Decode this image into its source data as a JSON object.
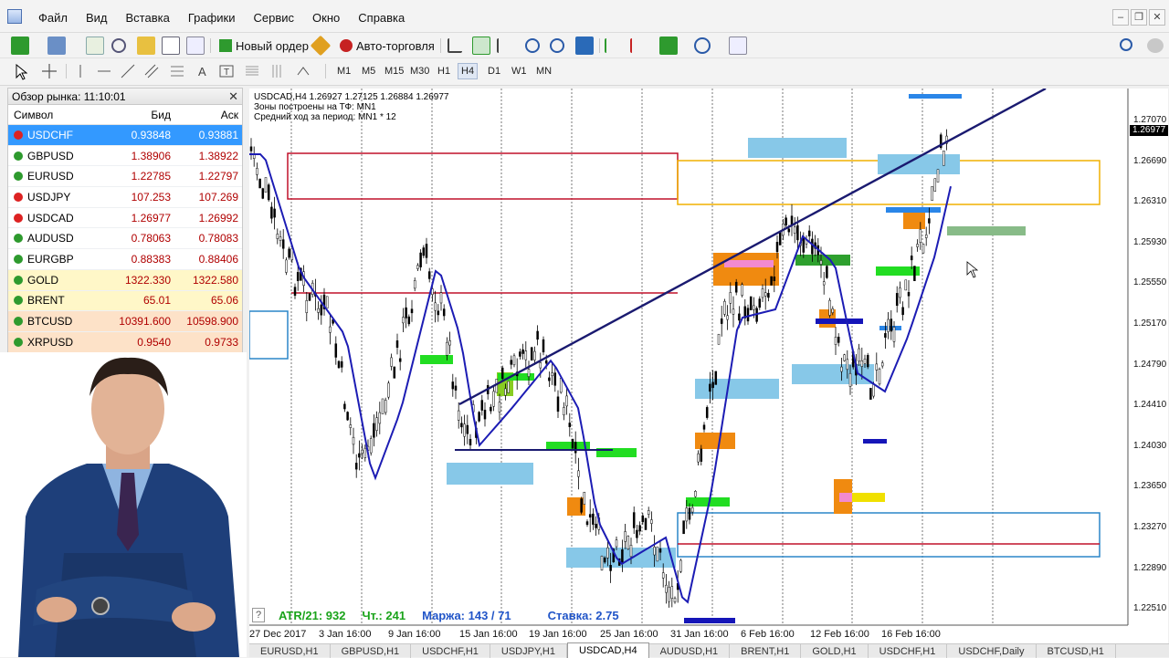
{
  "menu": {
    "items": [
      "Файл",
      "Вид",
      "Вставка",
      "Графики",
      "Сервис",
      "Окно",
      "Справка"
    ]
  },
  "toolbar": {
    "new_order": "Новый ордер",
    "auto_trading": "Авто-торговля",
    "timeframes": [
      "M1",
      "M5",
      "M15",
      "M30",
      "H1",
      "H4",
      "D1",
      "W1",
      "MN"
    ],
    "active_timeframe": "H4"
  },
  "market_watch": {
    "title": "Обзор рынка: 11:10:01",
    "col_symbol": "Символ",
    "col_bid": "Бид",
    "col_ask": "Аск",
    "rows": [
      {
        "symbol": "USDCHF",
        "bid": "0.93848",
        "ask": "0.93881",
        "dir": "down",
        "selected": true
      },
      {
        "symbol": "GBPUSD",
        "bid": "1.38906",
        "ask": "1.38922",
        "dir": "up"
      },
      {
        "symbol": "EURUSD",
        "bid": "1.22785",
        "ask": "1.22797",
        "dir": "up"
      },
      {
        "symbol": "USDJPY",
        "bid": "107.253",
        "ask": "107.269",
        "dir": "down"
      },
      {
        "symbol": "USDCAD",
        "bid": "1.26977",
        "ask": "1.26992",
        "dir": "down"
      },
      {
        "symbol": "AUDUSD",
        "bid": "0.78063",
        "ask": "0.78083",
        "dir": "up"
      },
      {
        "symbol": "EURGBP",
        "bid": "0.88383",
        "ask": "0.88406",
        "dir": "up"
      },
      {
        "symbol": "GOLD",
        "bid": "1322.330",
        "ask": "1322.580",
        "dir": "up"
      },
      {
        "symbol": "BRENT",
        "bid": "65.01",
        "ask": "65.06",
        "dir": "up"
      },
      {
        "symbol": "BTCUSD",
        "bid": "10391.600",
        "ask": "10598.900",
        "dir": "up"
      },
      {
        "symbol": "XRPUSD",
        "bid": "0.9540",
        "ask": "0.9733",
        "dir": "up"
      }
    ]
  },
  "chart": {
    "header_line1": "USDCAD,H4  1.26927 1.27125 1.26884 1.26977",
    "header_line2": "Зоны построены на ТФ: MN1",
    "header_line3": "Средний ход за период: MN1 * 12",
    "price_labels": [
      "1.27070",
      "1.26690",
      "1.26310",
      "1.25930",
      "1.25550",
      "1.25170",
      "1.24790",
      "1.24410",
      "1.24030",
      "1.23650",
      "1.23270",
      "1.22890",
      "1.22510"
    ],
    "current_price": "1.26977",
    "time_labels": [
      "27 Dec 2017",
      "3 Jan 16:00",
      "9 Jan 16:00",
      "15 Jan 16:00",
      "19 Jan 16:00",
      "25 Jan 16:00",
      "31 Jan 16:00",
      "6 Feb 16:00",
      "12 Feb 16:00",
      "16 Feb 16:00"
    ],
    "help": "?",
    "atr": "ATR/21: 932",
    "ticks": "Чт.: 241",
    "margin": "Маржа: 143 / 71",
    "rate": "Ставка: 2.75"
  },
  "tabs": [
    "EURUSD,H1",
    "GBPUSD,H1",
    "USDCHF,H1",
    "USDJPY,H1",
    "USDCAD,H4",
    "AUDUSD,H1",
    "BRENT,H1",
    "GOLD,H1",
    "USDCHF,H1",
    "USDCHF,Daily",
    "BTCUSD,H1"
  ],
  "active_tab": "USDCAD,H4",
  "colors": {
    "candle": "#000000",
    "ma": "#1c1cb4",
    "trendline": "#1a1a70",
    "zone_blue": "#87c8e8",
    "zone_orange": "#f08a10",
    "zone_green": "#22dd22",
    "zone_red_box": "#c0102a",
    "zone_yellow_box": "#f0b000",
    "selected_row": "#3399ff"
  }
}
